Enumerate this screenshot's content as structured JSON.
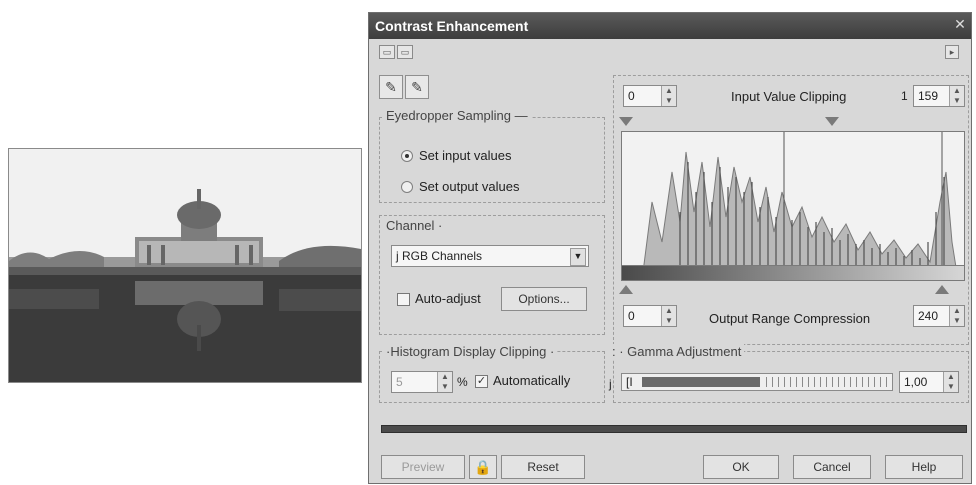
{
  "dialog": {
    "title": "Contrast Enhancement"
  },
  "eyedropper": {
    "label": "Eyedropper Sampling —",
    "options": [
      "Set input values",
      "Set output values"
    ],
    "selected": 0
  },
  "channel": {
    "label": "Channel ·",
    "value": "j RGB Channels",
    "auto_adjust_label": "Auto-adjust",
    "auto_adjust_checked": false,
    "options_button": "Options..."
  },
  "histogram_display": {
    "label": "·Histogram Display Clipping ·",
    "value": "5",
    "unit": "%",
    "auto_label": "Automatically",
    "auto_checked": true
  },
  "input_clipping": {
    "low": "0",
    "title": "Input Value Clipping",
    "high_prefix": "1",
    "high": "159"
  },
  "output_range": {
    "low": "0",
    "title": "Output Range Compression",
    "high": "240"
  },
  "gamma": {
    "label": ": · Gamma Adjustment",
    "prefix": "j",
    "left_text": "[I",
    "value": "1,00",
    "slider_fraction": 0.48
  },
  "buttons": {
    "preview": "Preview",
    "reset": "Reset",
    "ok": "OK",
    "cancel": "Cancel",
    "help": "Help"
  },
  "colors": {
    "dialog_bg": "#d8d8d8",
    "titlebar": "#4a4a4a"
  }
}
